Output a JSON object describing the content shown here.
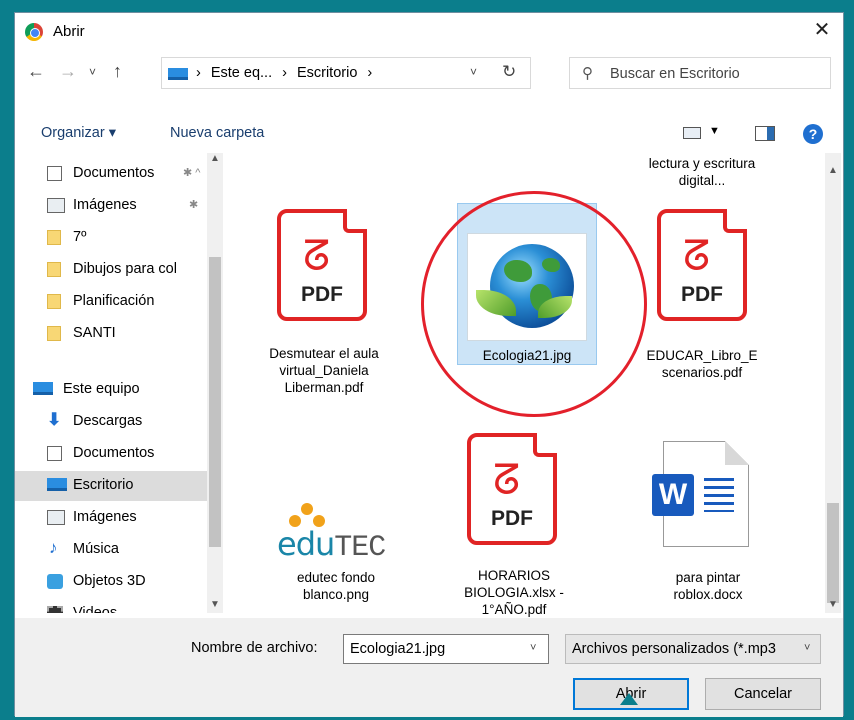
{
  "window": {
    "title": "Abrir",
    "close_glyph": "✕"
  },
  "nav": {
    "back": "←",
    "forward": "→",
    "recent": "˅",
    "up": "↑",
    "breadcrumb": [
      "›",
      "Este eq...",
      "›",
      "Escritorio",
      "›"
    ],
    "dropdown": "˅",
    "refresh": "↻",
    "search_icon": "⚲",
    "search_placeholder": "Buscar en Escritorio"
  },
  "toolbar": {
    "organize": "Organizar ▾",
    "new_folder": "Nueva carpeta",
    "view_dd": "▼",
    "help": "?"
  },
  "sidebar": {
    "items": [
      {
        "label": "Documentos",
        "icon": "document-icon",
        "pin": "✱ ^"
      },
      {
        "label": "Imágenes",
        "icon": "images-icon",
        "pin": "✱"
      },
      {
        "label": "7º",
        "icon": "folder-icon"
      },
      {
        "label": "Dibujos para col",
        "icon": "folder-icon"
      },
      {
        "label": "Planificación",
        "icon": "folder-icon"
      },
      {
        "label": "SANTI",
        "icon": "folder-icon"
      },
      {
        "label": "Este equipo",
        "icon": "computer-icon"
      },
      {
        "label": "Descargas",
        "icon": "download-icon"
      },
      {
        "label": "Documentos",
        "icon": "document-icon"
      },
      {
        "label": "Escritorio",
        "icon": "desktop-icon",
        "selected": true
      },
      {
        "label": "Imágenes",
        "icon": "images-icon"
      },
      {
        "label": "Música",
        "icon": "music-icon"
      },
      {
        "label": "Objetos 3D",
        "icon": "3d-objects-icon"
      },
      {
        "label": "Videos",
        "icon": "videos-icon"
      }
    ]
  },
  "files": {
    "top_partial": "lectura y escritura digital...",
    "desmutear": "Desmutear el aula virtual_Daniela Liberman.pdf",
    "ecologia": "Ecologia21.jpg",
    "educar": "EDUCAR_Libro_Escenarios.pdf",
    "edutec": "edutec fondo blanco.png",
    "horarios": "HORARIOS BIOLOGIA.xlsx - 1°AÑO.pdf",
    "roblox": "para pintar roblox.docx",
    "pdf_label": "PDF",
    "word_label": "W",
    "edutec_logo_a": "edu",
    "edutec_logo_b": "TEC"
  },
  "bottom": {
    "filename_label": "Nombre de archivo:",
    "filename_value": "Ecologia21.jpg",
    "filter_value": "Archivos personalizados (*.mp3",
    "open": "Abrir",
    "cancel": "Cancelar"
  },
  "colors": {
    "frame": "#0b7e8c",
    "pdf_red": "#e02424",
    "selection": "#cce4f7",
    "highlight_circle": "#e3202b"
  }
}
